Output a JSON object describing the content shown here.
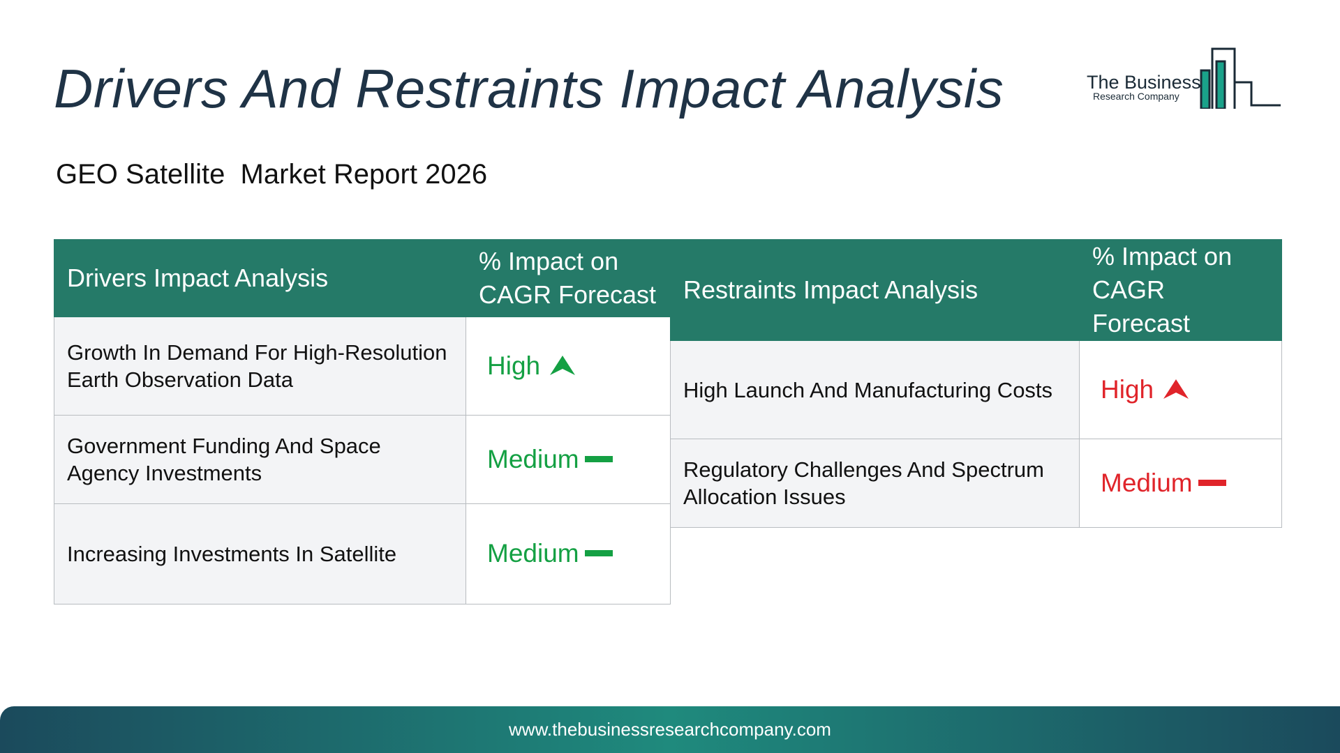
{
  "title": "Drivers And Restraints Impact Analysis",
  "subtitle": "GEO Satellite  Market Report 2026",
  "logo": {
    "line1": "The Business",
    "line2": "Research Company"
  },
  "drivers": {
    "header": "Drivers Impact Analysis",
    "impact_header": "% Impact on CAGR Forecast",
    "rows": [
      {
        "label": "Growth In Demand For High-Resolution Earth Observation Data",
        "impact": "High",
        "trend": "up"
      },
      {
        "label": "Government Funding And Space Agency Investments",
        "impact": "Medium",
        "trend": "flat"
      },
      {
        "label": "Increasing Investments In Satellite",
        "impact": "Medium",
        "trend": "flat"
      }
    ],
    "color": "#14a043"
  },
  "restraints": {
    "header": "Restraints Impact Analysis",
    "impact_header": "% Impact on CAGR Forecast",
    "rows": [
      {
        "label": "High Launch And Manufacturing Costs",
        "impact": "High",
        "trend": "up"
      },
      {
        "label": "Regulatory Challenges And Spectrum Allocation Issues",
        "impact": "Medium",
        "trend": "flat"
      }
    ],
    "color": "#e0242a"
  },
  "header_color": "#257a68",
  "footer": {
    "url": "www.thebusinessresearchcompany.com"
  }
}
